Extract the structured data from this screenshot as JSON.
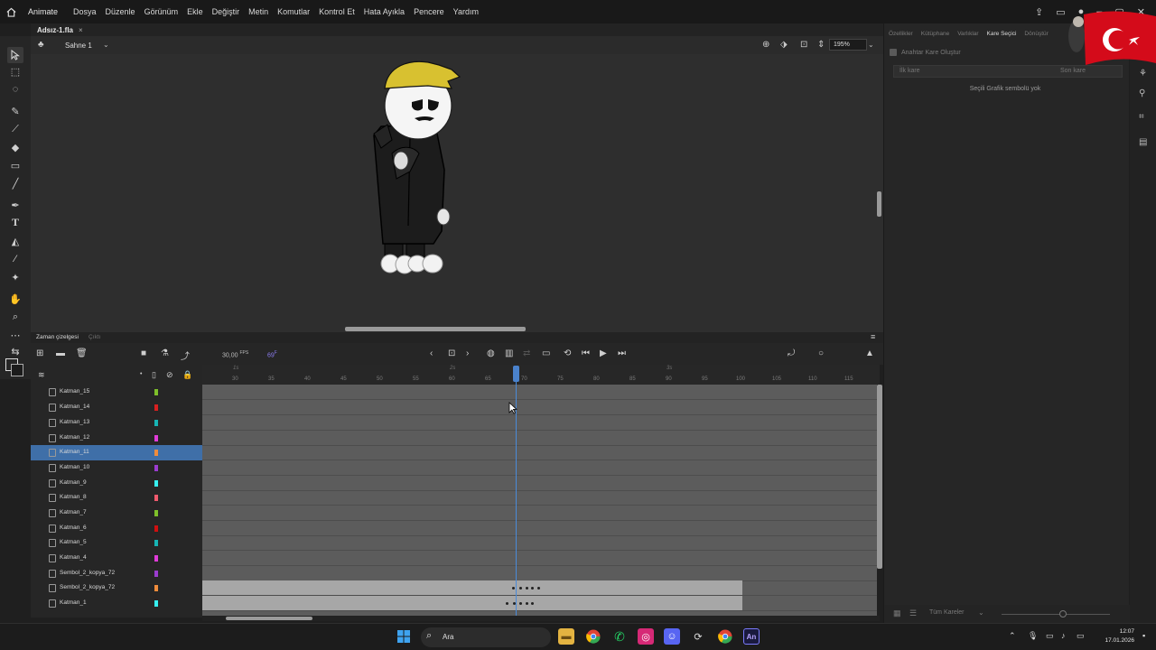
{
  "app": {
    "name": "Animate"
  },
  "menu": [
    "Dosya",
    "Düzenle",
    "Görünüm",
    "Ekle",
    "Değiştir",
    "Metin",
    "Komutlar",
    "Kontrol Et",
    "Hata Ayıkla",
    "Pencere",
    "Yardım"
  ],
  "document": {
    "tab": "Adsız-1.fla",
    "close": "×"
  },
  "scene": {
    "label": "Sahne 1",
    "zoom": "195%"
  },
  "properties": {
    "tabs": [
      "Özellikler",
      "Kütüphane",
      "Varlıklar",
      "Kare Seçici",
      "Dönüştür"
    ],
    "active_tab": "Kare Seçici",
    "create_keyframe": "Anahtar Kare Oluştur",
    "first_frame": "İlk kare",
    "last_frame": "Son kare",
    "empty_message": "Seçili Grafik sembolü yok",
    "all_frames": "Tüm Kareler"
  },
  "timeline": {
    "title": "Zaman çizelgesi",
    "output": "Çıktı",
    "fps": "30,00",
    "fps_unit": "FPS",
    "current_frame": "69",
    "frame_unit": "F",
    "seconds": [
      "1s",
      "2s",
      "3s"
    ],
    "ruler": [
      "30",
      "35",
      "40",
      "45",
      "50",
      "55",
      "60",
      "65",
      "70",
      "75",
      "80",
      "85",
      "90",
      "95",
      "100",
      "105",
      "110",
      "115"
    ],
    "layers": [
      {
        "name": "Katman_15",
        "color": "#7ec02a"
      },
      {
        "name": "Katman_14",
        "color": "#d82020"
      },
      {
        "name": "Katman_13",
        "color": "#17b4b4"
      },
      {
        "name": "Katman_12",
        "color": "#e03cd8"
      },
      {
        "name": "Katman_11",
        "color": "#f08c3c",
        "selected": true
      },
      {
        "name": "Katman_10",
        "color": "#9b3ccf"
      },
      {
        "name": "Katman_9",
        "color": "#36f0f0"
      },
      {
        "name": "Katman_8",
        "color": "#f05a6e"
      },
      {
        "name": "Katman_7",
        "color": "#7ec02a"
      },
      {
        "name": "Katman_6",
        "color": "#d01010"
      },
      {
        "name": "Katman_5",
        "color": "#17b4b4"
      },
      {
        "name": "Katman_4",
        "color": "#e03cd8"
      },
      {
        "name": "Sembol_2_kopya_72",
        "color": "#9b3ccf"
      },
      {
        "name": "Sembol_2_kopya_72",
        "color": "#f08c3c"
      },
      {
        "name": "Katman_1",
        "color": "#36f0f0"
      }
    ]
  },
  "taskbar": {
    "search": "Ara",
    "time": "12:07",
    "date": "17.01.2026"
  }
}
